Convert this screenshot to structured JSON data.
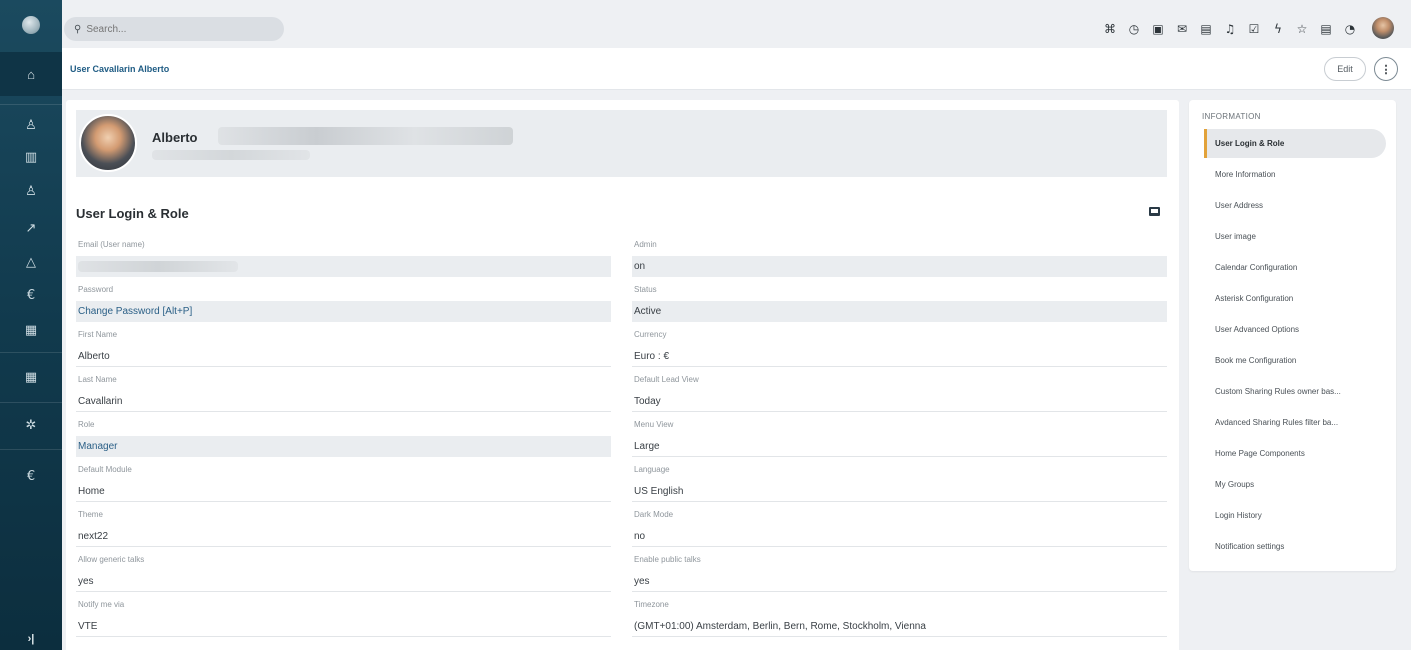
{
  "search": {
    "placeholder": "Search..."
  },
  "topbar": {
    "icons": [
      "sitemap-icon",
      "history-icon",
      "calendar-icon",
      "mail-icon",
      "chat-icon",
      "bell-icon",
      "task-icon",
      "bolt-icon",
      "star-icon",
      "document-icon",
      "timer-icon"
    ]
  },
  "header": {
    "breadcrumb": "User Cavallarin Alberto",
    "edit_label": "Edit",
    "more_label": "⋮"
  },
  "profile": {
    "first_name": "Alberto"
  },
  "section": {
    "title": "User Login & Role"
  },
  "fields_left": [
    {
      "label": "Email (User name)",
      "value": ""
    },
    {
      "label": "Password",
      "value": "Change Password [Alt+P]"
    },
    {
      "label": "First Name",
      "value": "Alberto"
    },
    {
      "label": "Last Name",
      "value": "Cavallarin"
    },
    {
      "label": "Role",
      "value": "Manager"
    },
    {
      "label": "Default Module",
      "value": "Home"
    },
    {
      "label": "Theme",
      "value": "next22"
    },
    {
      "label": "Allow generic talks",
      "value": "yes"
    },
    {
      "label": "Notify me via",
      "value": "VTE"
    }
  ],
  "fields_right": [
    {
      "label": "Admin",
      "value": "on"
    },
    {
      "label": "Status",
      "value": "Active"
    },
    {
      "label": "Currency",
      "value": "Euro : €"
    },
    {
      "label": "Default Lead View",
      "value": "Today"
    },
    {
      "label": "Menu View",
      "value": "Large"
    },
    {
      "label": "Language",
      "value": "US English"
    },
    {
      "label": "Dark Mode",
      "value": "no"
    },
    {
      "label": "Enable public talks",
      "value": "yes"
    },
    {
      "label": "Timezone",
      "value": "(GMT+01:00) Amsterdam, Berlin, Bern, Rome, Stockholm, Vienna"
    }
  ],
  "info_panel": {
    "heading": "INFORMATION",
    "items": [
      "User Login & Role",
      "More Information",
      "User Address",
      "User image",
      "Calendar Configuration",
      "Asterisk Configuration",
      "User Advanced Options",
      "Book me Configuration",
      "Custom Sharing Rules owner bas...",
      "Avdanced Sharing Rules filter ba...",
      "Home Page Components",
      "My Groups",
      "Login History",
      "Notification settings"
    ],
    "active_index": 0
  },
  "rail": {
    "collapse_label": "›|"
  },
  "colors": {
    "accent": "#e2a23a",
    "rail": "#113a4d",
    "link": "#1f5c84"
  }
}
